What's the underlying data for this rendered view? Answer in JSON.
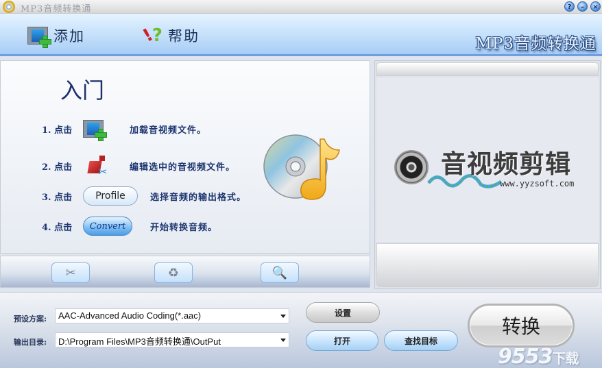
{
  "window": {
    "title": "MP3音频转换通",
    "controls": {
      "help": "?",
      "minimize": "–",
      "close": "×"
    }
  },
  "toolbar": {
    "add_label": "添加",
    "help_label": "帮助",
    "brand": "MP3音频转换通"
  },
  "intro": {
    "title": "入门",
    "steps": [
      {
        "num": "1. 点击",
        "icon": "add-media-icon",
        "desc": "加载音视频文件。"
      },
      {
        "num": "2. 点击",
        "icon": "edit-icon",
        "desc": "编辑选中的音视频文件。"
      },
      {
        "num": "3. 点击",
        "button": "Profile",
        "desc": "选择音频的输出格式。"
      },
      {
        "num": "4. 点击",
        "button": "Convert",
        "desc": "开始转换音频。"
      }
    ]
  },
  "tools": [
    {
      "name": "cut",
      "icon": "scissors-icon",
      "glyph": "✂"
    },
    {
      "name": "delete",
      "icon": "recycle-bin-icon",
      "glyph": "♻"
    },
    {
      "name": "find",
      "icon": "magnifier-icon",
      "glyph": "🔍"
    }
  ],
  "preview": {
    "logo_text": "音视频剪辑",
    "logo_url": "www.yyzsoft.com"
  },
  "settings": {
    "preset_label": "预设方案:",
    "preset_value": "AAC-Advanced Audio Coding(*.aac)",
    "output_label": "输出目录:",
    "output_value": "D:\\Program Files\\MP3音频转换通\\OutPut",
    "settings_button": "设置",
    "open_button": "打开",
    "find_target_button": "查找目标",
    "convert_button": "转换"
  },
  "watermark": {
    "text": "9553",
    "suffix": "下载"
  }
}
